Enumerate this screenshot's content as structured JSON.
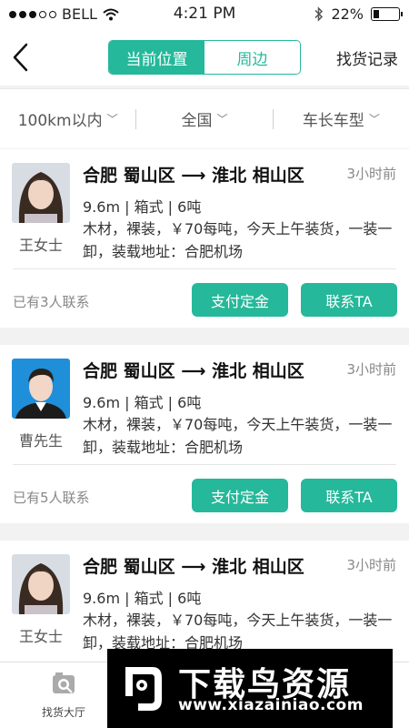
{
  "status_bar": {
    "carrier": "BELL",
    "time": "4:21 PM",
    "battery": "22%",
    "battery_level": 0.22
  },
  "nav": {
    "segments": [
      "当前位置",
      "周边"
    ],
    "active_segment": 0,
    "record_label": "找货记录"
  },
  "filters": [
    "100km以内",
    "全国",
    "车长车型"
  ],
  "listings": [
    {
      "person": "王女士",
      "route": "合肥 蜀山区 ⟶ 淮北 相山区",
      "time_ago": "3小时前",
      "spec": "9.6m | 箱式 | 6吨",
      "desc": "木材，裸装，￥70每吨，今天上午装货，一装一卸，装载地址：合肥机场",
      "contacted": "已有3人联系",
      "pay_label": "支付定金",
      "contact_label": "联系TA"
    },
    {
      "person": "曹先生",
      "route": "合肥 蜀山区 ⟶ 淮北 相山区",
      "time_ago": "3小时前",
      "spec": "9.6m | 箱式 | 6吨",
      "desc": "木材，裸装，￥70每吨，今天上午装货，一装一卸，装载地址：合肥机场",
      "contacted": "已有5人联系",
      "pay_label": "支付定金",
      "contact_label": "联系TA"
    },
    {
      "person": "王女士",
      "route": "合肥 蜀山区 ⟶ 淮北 相山区",
      "time_ago": "3小时前",
      "spec": "9.6m | 箱式 | 6吨",
      "desc": "木材，裸装，￥70每吨，今天上午装货，一装一卸，装载地址：合肥机场"
    }
  ],
  "tabbar": {
    "hall_label": "找货大厅"
  },
  "watermark": {
    "title": "下载鸟资源",
    "url": "www.xiazainiao.com"
  },
  "colors": {
    "accent": "#25b89a"
  }
}
